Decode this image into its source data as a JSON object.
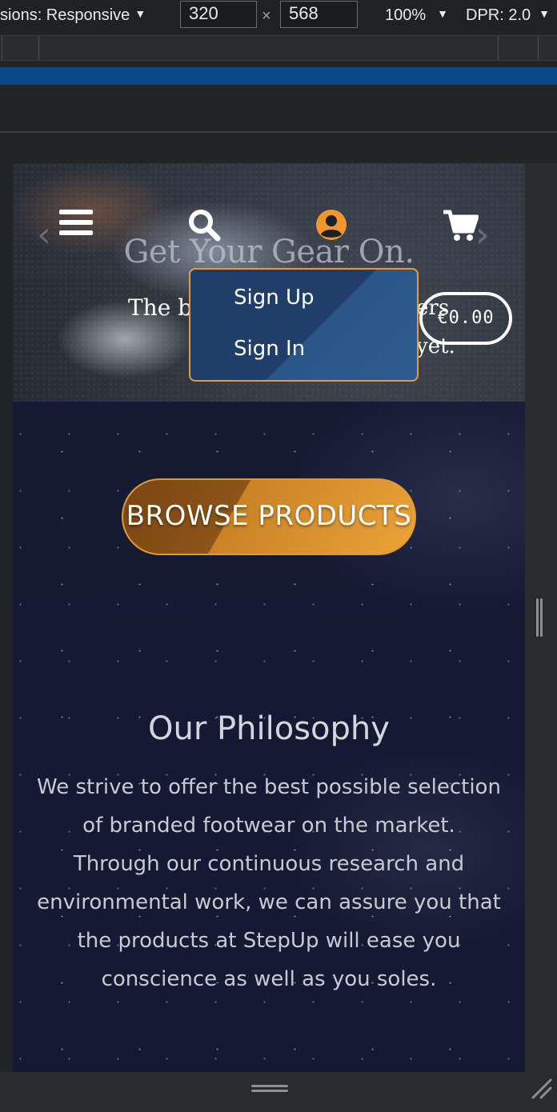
{
  "devtools": {
    "dimensions_label": "sions: Responsive",
    "width_value": "320",
    "height_value": "568",
    "times": "×",
    "zoom": "100%",
    "dpr": "DPR: 2.0"
  },
  "hero": {
    "title": "Get Your Gear On.",
    "subtitle_left": "The b",
    "subtitle_right_1": "ers",
    "subtitle_right_2": "yet.",
    "cart_total": "€0.00"
  },
  "account_menu": {
    "items": [
      "Sign Up",
      "Sign In"
    ]
  },
  "main": {
    "browse_button": "BROWSE PRODUCTS",
    "philosophy_title": "Our Philosophy",
    "philosophy_text": "We strive to offer the best possible selection of branded footwear on the market. Through our continuous research and environmental work, we can assure you that the products at StepUp will ease you conscience as well as you soles."
  },
  "colors": {
    "accent": "#e59b36",
    "dropdown_bg": "#1f3f6a",
    "progress_bar": "#0b4a86"
  },
  "icons": {
    "menu": "hamburger-menu-icon",
    "search": "search-icon",
    "account": "user-circle-icon",
    "cart": "shopping-cart-icon"
  }
}
